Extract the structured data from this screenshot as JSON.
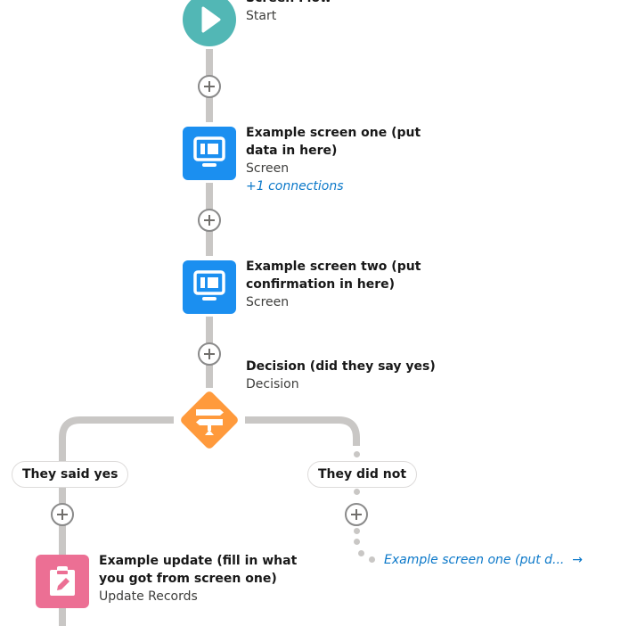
{
  "start": {
    "title": "Screen Flow",
    "type": "Start"
  },
  "nodes": [
    {
      "title": "Example screen one (put data in here)",
      "type": "Screen",
      "connections": "+1 connections"
    },
    {
      "title": "Example screen two (put confirmation in here)",
      "type": "Screen"
    }
  ],
  "decision": {
    "title": "Decision (did they say yes)",
    "type": "Decision",
    "branches": [
      {
        "label": "They said yes"
      },
      {
        "label": "They did not"
      }
    ]
  },
  "update": {
    "title": "Example update (fill in what you got from screen one)",
    "type": "Update Records"
  },
  "goto": {
    "label": "Example screen one (put d...",
    "arrow": "→"
  },
  "colors": {
    "start": "#52b7b5",
    "screen": "#1b8ff0",
    "decision": "#ff9a3c",
    "update": "#ec6f94",
    "link": "#0b78c9",
    "connector": "#c9c7c5"
  }
}
